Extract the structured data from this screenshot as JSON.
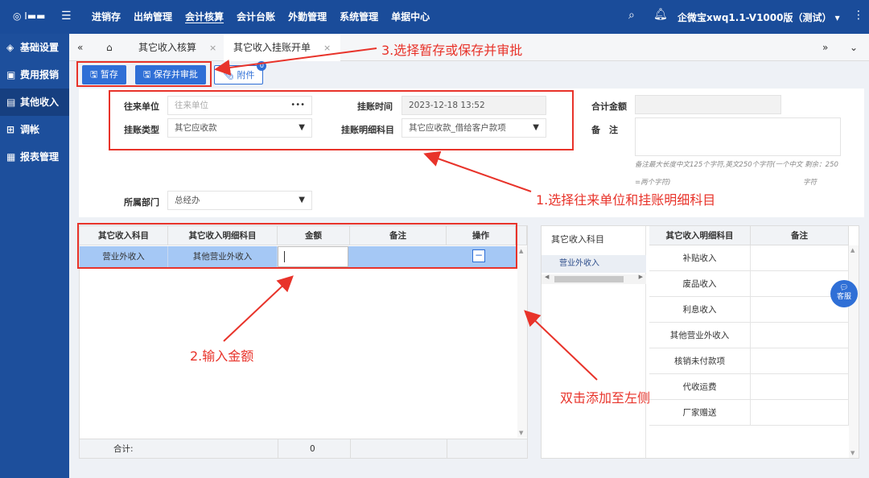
{
  "topbar": {
    "user": "◎ I▬▬",
    "nav": [
      "进销存",
      "出纳管理",
      "会计核算",
      "会计台账",
      "外勤管理",
      "系统管理",
      "单据中心"
    ],
    "active_nav": "会计核算",
    "company": "企微宝xwq1.1-V1000版（测试）"
  },
  "sidebar": {
    "items": [
      {
        "icon": "layers-icon",
        "label": "基础设置"
      },
      {
        "icon": "receipt-icon",
        "label": "费用报销"
      },
      {
        "icon": "income-icon",
        "label": "其他收入"
      },
      {
        "icon": "adjust-icon",
        "label": "调帐"
      },
      {
        "icon": "report-icon",
        "label": "报表管理"
      }
    ],
    "active_index": 2
  },
  "tabs": {
    "items": [
      "其它收入核算",
      "其它收入挂账开单"
    ],
    "active_index": 1
  },
  "toolbar": {
    "save_draft": "暂存",
    "save_approve": "保存并审批",
    "attachment": "附件",
    "attachment_count": "0"
  },
  "form": {
    "partner_label": "往来单位",
    "partner_placeholder": "往来单位",
    "charge_time_label": "挂账时间",
    "charge_time_value": "2023-12-18 13:52",
    "total_label": "合计金额",
    "type_label": "挂账类型",
    "type_value": "其它应收款",
    "detail_label": "挂账明细科目",
    "detail_value": "其它应收款_借给客户款项",
    "remark_label": "备　注",
    "remark_hint_1": "备注最大长度中文125个字符,英文250个字符(一个中文  剩余：250",
    "remark_hint_2": "=两个字符)",
    "remark_hint_3": "字符",
    "dept_label": "所属部门",
    "dept_value": "总经办"
  },
  "left_grid": {
    "headers": [
      "其它收入科目",
      "其它收入明细科目",
      "金额",
      "备注",
      "操作"
    ],
    "rows": [
      [
        "营业外收入",
        "其他营业外收入",
        "",
        "",
        "−"
      ]
    ],
    "footer_label": "合计:",
    "footer_amount": "0"
  },
  "right_panel": {
    "subject_header": "其它收入科目",
    "subject_items": [
      "营业外收入"
    ],
    "headers": [
      "其它收入明细科目",
      "备注"
    ],
    "rows": [
      "补贴收入",
      "废品收入",
      "利息收入",
      "其他营业外收入",
      "核销未付款项",
      "代收运费",
      "厂家赠送"
    ]
  },
  "annotations": {
    "step1": "1.选择往来单位和挂账明细科目",
    "step2": "2.输入金额",
    "step3": "3.选择暂存或保存并审批",
    "dblclick": "双击添加至左侧"
  },
  "kefu": "客服",
  "colors": {
    "brand": "#1d4f9c",
    "accent": "#2f6fd6",
    "annotation": "#e8332a",
    "selected_row": "#a5c8f5"
  }
}
